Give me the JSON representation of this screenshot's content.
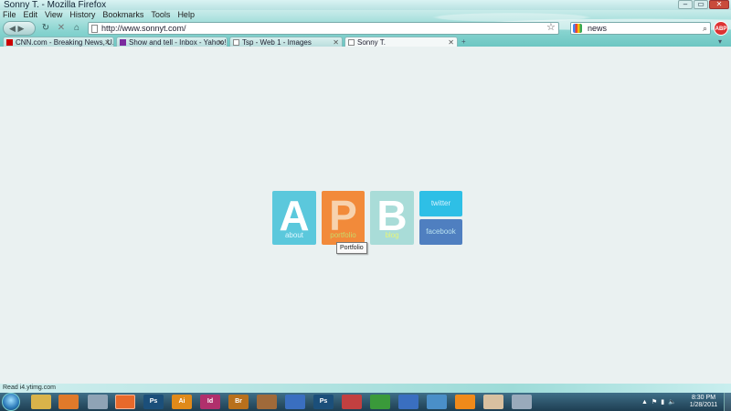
{
  "window": {
    "title": "Sonny T. - Mozilla Firefox"
  },
  "menu": {
    "items": [
      "File",
      "Edit",
      "View",
      "History",
      "Bookmarks",
      "Tools",
      "Help"
    ]
  },
  "navigation": {
    "url": "http://www.sonnyt.com/",
    "search_value": "news"
  },
  "tabs": [
    {
      "label": "CNN.com - Breaking News, U.S., W...",
      "favicon": "cnn-icon",
      "active": false
    },
    {
      "label": "Show and tell - Inbox - Yahoo! Mail",
      "favicon": "yahoo-icon",
      "active": false
    },
    {
      "label": "Tsp - Web 1 - Images",
      "favicon": "page-icon",
      "active": false
    },
    {
      "label": "Sonny T.",
      "favicon": "page-icon",
      "active": true
    }
  ],
  "tiles": {
    "about": {
      "letter": "A",
      "label": "about",
      "color": "#5bc8dc"
    },
    "portfolio": {
      "letter": "P",
      "label": "portfolio",
      "color": "#f28a3a"
    },
    "blog": {
      "letter": "B",
      "label": "blog",
      "color": "#a9dcd8"
    },
    "twitter": {
      "label": "twitter",
      "color": "#2ebfe6"
    },
    "facebook": {
      "label": "facebook",
      "color": "#4f7fc0"
    }
  },
  "tooltip": {
    "text": "Portfolio"
  },
  "status": {
    "text": "Read i4.ytimg.com"
  },
  "taskbar": {
    "apps": [
      {
        "name": "explorer-icon",
        "label": "",
        "color": "#d9b34a"
      },
      {
        "name": "media-player-icon",
        "label": "",
        "color": "#e07a2a"
      },
      {
        "name": "app-icon",
        "label": "",
        "color": "#8fa3b5"
      },
      {
        "name": "firefox-icon",
        "label": "",
        "color": "#e8692a",
        "active": true
      },
      {
        "name": "photoshop-icon",
        "label": "Ps",
        "color": "#1b4f7a"
      },
      {
        "name": "illustrator-icon",
        "label": "Ai",
        "color": "#e08a1a"
      },
      {
        "name": "indesign-icon",
        "label": "Id",
        "color": "#b0306c"
      },
      {
        "name": "bridge-icon",
        "label": "Br",
        "color": "#b8701c"
      },
      {
        "name": "archive-icon",
        "label": "",
        "color": "#a06a3a"
      },
      {
        "name": "messenger-icon",
        "label": "",
        "color": "#3a6fc0"
      },
      {
        "name": "photoshop-icon-2",
        "label": "Ps",
        "color": "#1b4f7a"
      },
      {
        "name": "itunes-icon",
        "label": "",
        "color": "#c24040"
      },
      {
        "name": "updater-icon",
        "label": "",
        "color": "#3a9a3a"
      },
      {
        "name": "checkmark-app-icon",
        "label": "",
        "color": "#3a6fc0"
      },
      {
        "name": "shield-app-icon",
        "label": "",
        "color": "#4a8fc8"
      },
      {
        "name": "vlc-icon",
        "label": "",
        "color": "#f08a1a"
      },
      {
        "name": "paint-icon",
        "label": "",
        "color": "#d8c0a0"
      },
      {
        "name": "window-app-icon",
        "label": "",
        "color": "#9ab"
      }
    ],
    "clock_time": "8:30 PM",
    "clock_date": "1/28/2011"
  },
  "colors": {
    "page_bg": "#eaf1f1",
    "chrome_teal": "#86d3cf"
  }
}
